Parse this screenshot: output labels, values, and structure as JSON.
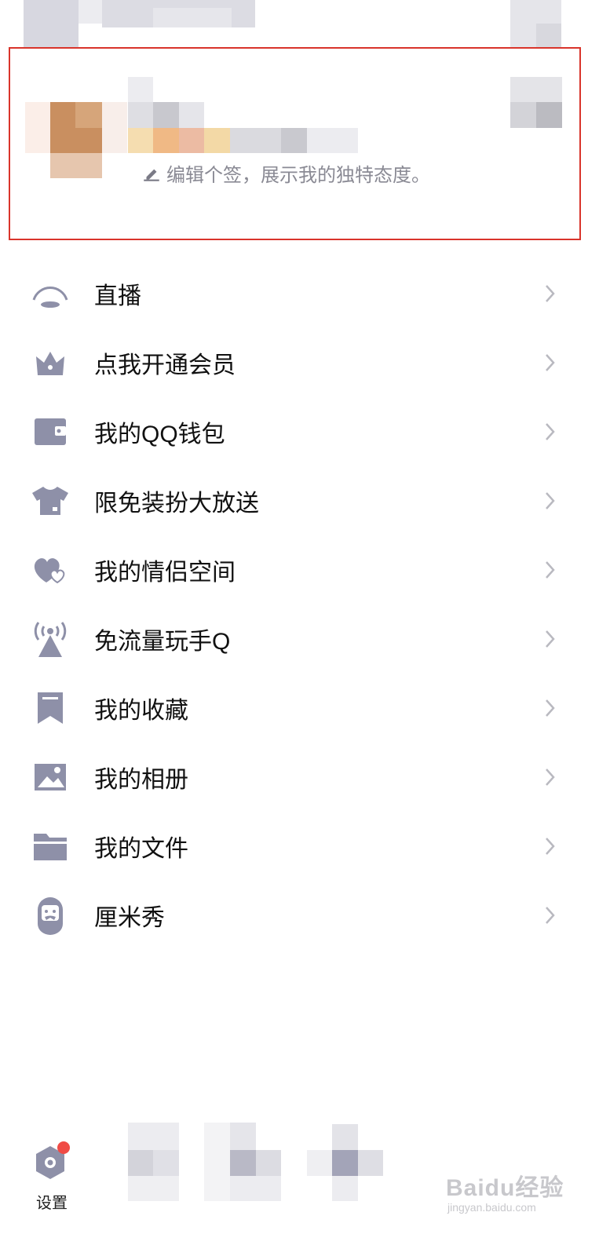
{
  "profile": {
    "signature_hint": "编辑个签，展示我的独特态度。",
    "icons": {
      "edit": "pencil-icon"
    },
    "colors": {
      "highlight_border": "#d9342b"
    }
  },
  "menu": {
    "items": [
      {
        "label": "直播",
        "icon": "live-icon"
      },
      {
        "label": "点我开通会员",
        "icon": "crown-icon"
      },
      {
        "label": "我的QQ钱包",
        "icon": "wallet-icon"
      },
      {
        "label": "限免装扮大放送",
        "icon": "shirt-icon"
      },
      {
        "label": "我的情侣空间",
        "icon": "hearts-icon"
      },
      {
        "label": "免流量玩手Q",
        "icon": "signal-tower-icon"
      },
      {
        "label": "我的收藏",
        "icon": "bookmark-icon"
      },
      {
        "label": "我的相册",
        "icon": "photo-icon"
      },
      {
        "label": "我的文件",
        "icon": "folder-icon"
      },
      {
        "label": "厘米秀",
        "icon": "cmshow-icon"
      }
    ],
    "icon_color": "#8e90a8",
    "chevron_color": "#b9b9c0"
  },
  "bottom_bar": {
    "settings_label": "设置",
    "settings_icon": "gear-icon",
    "badge_color": "#f04b45"
  },
  "watermark": {
    "text": "Baidu经验",
    "sub": "jingyan.baidu.com"
  }
}
